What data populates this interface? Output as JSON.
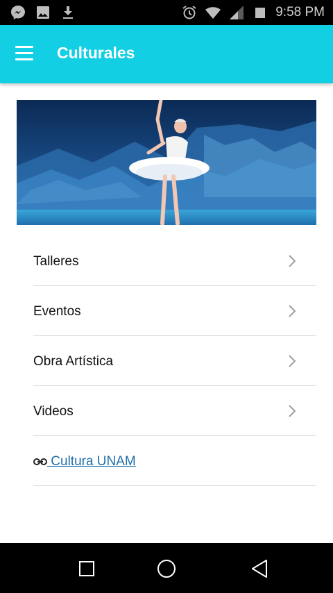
{
  "status_bar": {
    "time": "9:58 PM",
    "left_icons": [
      "messenger-icon",
      "image-icon",
      "download-icon"
    ],
    "right_icons": [
      "alarm-icon",
      "wifi-icon",
      "signal-icon",
      "battery-icon"
    ]
  },
  "app_bar": {
    "title": "Culturales",
    "menu_icon": "hamburger-menu-icon",
    "color": "#12cfe3"
  },
  "hero": {
    "subject": "ballerina-banner"
  },
  "menu": {
    "items": [
      {
        "label": "Talleres"
      },
      {
        "label": "Eventos"
      },
      {
        "label": "Obra Artística"
      },
      {
        "label": "Videos"
      }
    ],
    "link": {
      "label": " Cultura UNAM",
      "icon": "link-icon",
      "color": "#1e6fa8"
    }
  },
  "nav_bar": {
    "buttons": [
      "recents-button",
      "home-button",
      "back-button"
    ]
  }
}
